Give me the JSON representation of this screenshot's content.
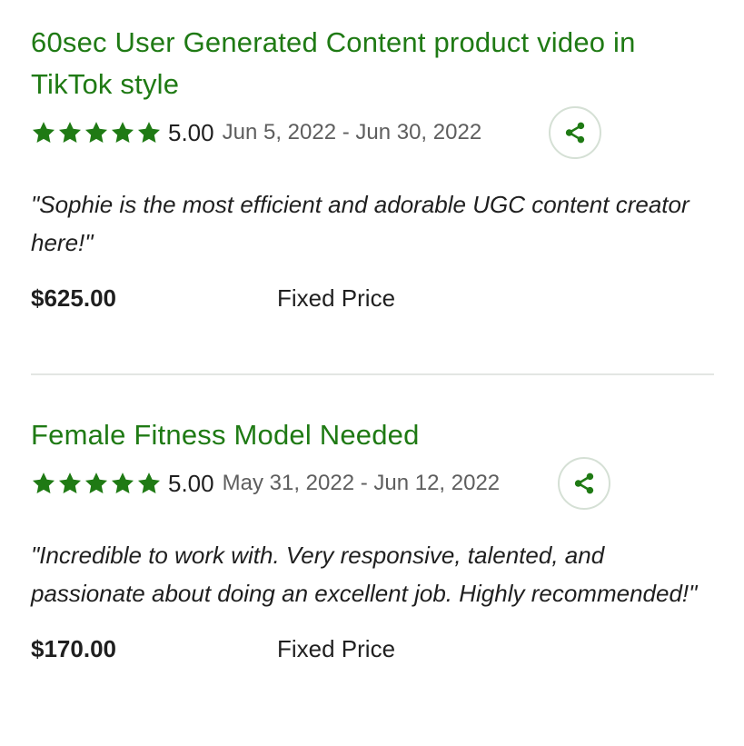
{
  "colors": {
    "accent_green": "#1f7a14",
    "text_dark": "#1f1f1f",
    "text_muted": "#5e5e5e",
    "divider": "#e3e6e3"
  },
  "icons": {
    "star": "star-icon",
    "share": "share-icon"
  },
  "jobs": [
    {
      "title": "60sec User Generated Content product video in TikTok style",
      "stars": 5,
      "score": "5.00",
      "dates": "Jun 5, 2022 - Jun 30, 2022",
      "quote": "\"Sophie is the most efficient and adorable UGC content creator here!\"",
      "price": "$625.00",
      "price_type": "Fixed Price"
    },
    {
      "title": "Female Fitness Model Needed",
      "stars": 5,
      "score": "5.00",
      "dates": "May 31, 2022 - Jun 12, 2022",
      "quote": "\"Incredible to work with. Very responsive, talented, and passionate about doing an excellent job. Highly recommended!\"",
      "price": "$170.00",
      "price_type": "Fixed Price"
    }
  ]
}
